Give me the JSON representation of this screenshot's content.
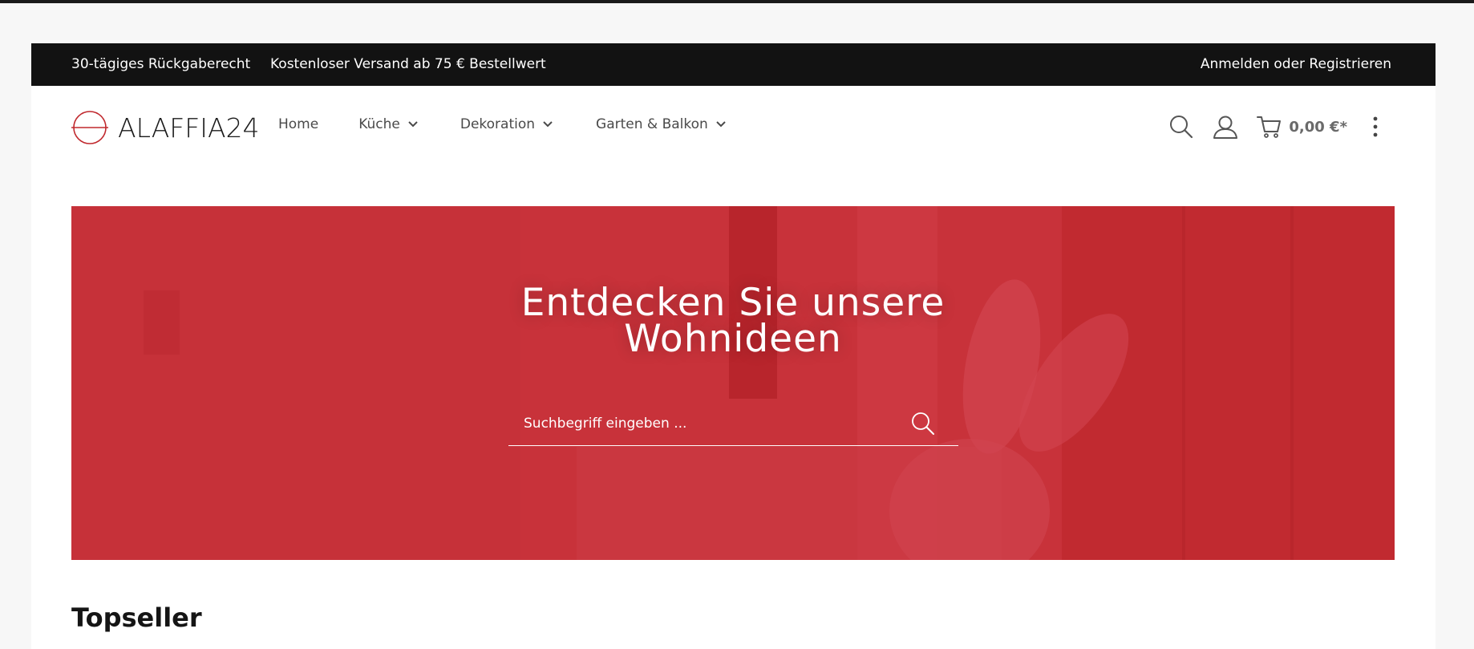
{
  "topbar": {
    "promo_returns": "30-tägiges Rückgaberecht",
    "promo_shipping": "Kostenloser Versand ab 75 € Bestellwert",
    "account_link": "Anmelden oder Registrieren"
  },
  "header": {
    "logo_text": "ALAFFIA24",
    "nav": {
      "home": "Home",
      "kueche": "Küche",
      "dekoration": "Dekoration",
      "garten": "Garten & Balkon"
    },
    "cart_total": "0,00 €*",
    "icons": [
      "search-icon",
      "user-icon",
      "cart-icon",
      "more-vertical-icon",
      "chevron-down-icon"
    ]
  },
  "hero": {
    "title_line1": "Entdecken Sie unsere",
    "title_line2": "Wohnideen",
    "search_placeholder": "Suchbegriff eingeben ..."
  },
  "sections": {
    "topseller_title": "Topseller"
  },
  "colors": {
    "topbar_bg": "#121212",
    "hero_red": "#c8323a",
    "logo_red": "#c0282d",
    "text_dark": "#151515",
    "nav_text": "#4a4a4a"
  }
}
